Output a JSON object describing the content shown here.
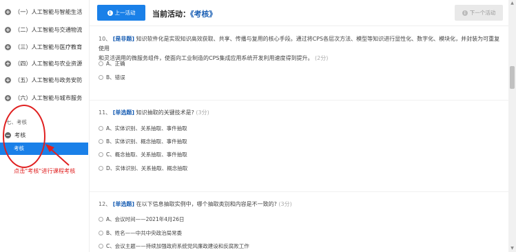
{
  "sidebar": {
    "items": [
      {
        "label": "（一）人工智能与智能生活"
      },
      {
        "label": "（二）人工智能与交通物流"
      },
      {
        "label": "（三）人工智能与医疗教育"
      },
      {
        "label": "（四）人工智能与农业资源"
      },
      {
        "label": "（五）人工智能与政务安防"
      },
      {
        "label": "（六）人工智能与城市服务"
      }
    ],
    "section_title": "七、考核",
    "group_label": "考核",
    "active_sub": "考核"
  },
  "annotation": {
    "text": "点击\"考核\"进行课程考核",
    "color": "#e02020"
  },
  "topbar": {
    "prev_label": "上一活动",
    "current_prefix": "当前活动：",
    "current_name": "《考核》",
    "next_label": "下一个活动"
  },
  "questions": [
    {
      "num": "10、",
      "type": "[是非题]",
      "text_line1": "知识软件化是实现知识高效获取、共享、传播与复用的核心手段。通过将CPS各层次方法、模型等知识进行显性化、数字化、模块化，并封装为可重复使用",
      "text_line2": "和灵活调用的微服务组件，使面向工业制造的CPS集成应用系统开发利用速度得到提升。",
      "score": "(2分)",
      "options": [
        "A、正确",
        "B、错误"
      ]
    },
    {
      "num": "11、",
      "type": "[单选题]",
      "text_line1": "知识抽取的关键技术是?",
      "score": "(3分)",
      "options": [
        "A、实体识别、关系抽取、事件抽取",
        "B、实体识别、概念抽取、事件抽取",
        "C、概念抽取、关系抽取、事件抽取",
        "D、实体识别、关系抽取、概念抽取"
      ]
    },
    {
      "num": "12、",
      "type": "[单选题]",
      "text_line1": "在以下信息抽取实例中，哪个抽取类别和内容是不一致的?",
      "score": "(3分)",
      "options": [
        "A、会议时间——2021年4月26日",
        "B、姓名——中共中央政治局常委",
        "C、会议主题——持续加强政府系统党风廉政建设和反腐败工作"
      ]
    }
  ],
  "colors": {
    "accent": "#1a80e8",
    "type_label": "#1a5fb4",
    "annotation": "#e02020"
  }
}
